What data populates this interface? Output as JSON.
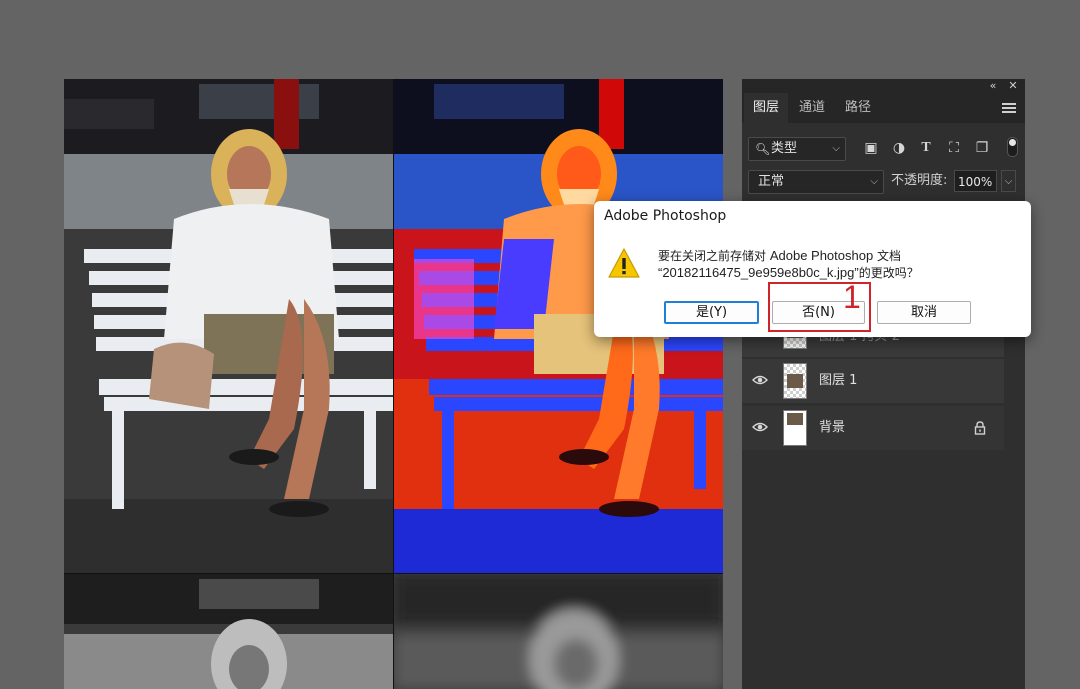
{
  "panel": {
    "tabs": [
      "图层",
      "通道",
      "路径"
    ],
    "filter": {
      "value": "类型"
    },
    "blend_mode": "正常",
    "opacity_label": "不透明度:",
    "opacity_value": "100%",
    "layers": [
      {
        "name": "图层 1 拷贝 2",
        "partial": true
      },
      {
        "name": "图层 1",
        "visible": true
      },
      {
        "name": "背景",
        "visible": true,
        "locked": true
      }
    ]
  },
  "dialog": {
    "title": "Adobe Photoshop",
    "message_prefix": "要在关闭之前存储对 ",
    "message_app": "Adobe Photoshop",
    "message_suffix": " 文档",
    "filename_line": "“20182116475_9e959e8b0c_k.jpg”",
    "filename_suffix": "的更改吗？",
    "buttons": {
      "yes": "是(Y)",
      "no": "否(N)",
      "cancel": "取消"
    }
  },
  "annotation": {
    "number": "1",
    "color": "#d0232a"
  },
  "colors": {
    "app_bg": "#646464",
    "panel_bg": "#2f2f2f",
    "accent": "#1e7fd6"
  }
}
